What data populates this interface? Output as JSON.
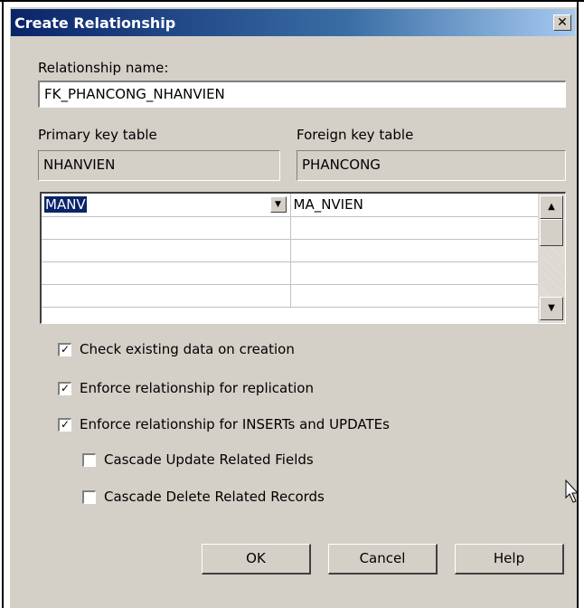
{
  "dialog": {
    "title": "Create Relationship",
    "close_glyph": "✕"
  },
  "relationship": {
    "name_label": "Relationship name:",
    "name_value": "FK_PHANCONG_NHANVIEN"
  },
  "tables": {
    "primary_label": "Primary key table",
    "primary_value": "NHANVIEN",
    "foreign_label": "Foreign key table",
    "foreign_value": "PHANCONG"
  },
  "columns": {
    "rows": [
      {
        "primary": "MANV",
        "foreign": "MA_NVIEN"
      },
      {
        "primary": "",
        "foreign": ""
      },
      {
        "primary": "",
        "foreign": ""
      },
      {
        "primary": "",
        "foreign": ""
      },
      {
        "primary": "",
        "foreign": ""
      }
    ]
  },
  "options": {
    "check_existing": {
      "label": "Check existing data on creation",
      "checked": true
    },
    "enforce_replication": {
      "label": "Enforce relationship for replication",
      "checked": true
    },
    "enforce_inserts": {
      "label": "Enforce relationship for INSERTs and UPDATEs",
      "checked": true
    },
    "cascade_update": {
      "label": "Cascade Update Related Fields",
      "checked": false
    },
    "cascade_delete": {
      "label": "Cascade Delete Related Records",
      "checked": false
    }
  },
  "buttons": {
    "ok": "OK",
    "cancel": "Cancel",
    "help": "Help"
  },
  "icons": {
    "combo_arrow": "chevron-down-icon",
    "scroll_up": "scroll-up-icon",
    "scroll_down": "scroll-down-icon",
    "check_mark": "check-icon",
    "cursor": "mouse-cursor-icon"
  },
  "colors": {
    "dialog_bg": "#d4d0c8",
    "titlebar_start": "#0a246a",
    "titlebar_end": "#a6caf0",
    "selection": "#0a246a"
  }
}
